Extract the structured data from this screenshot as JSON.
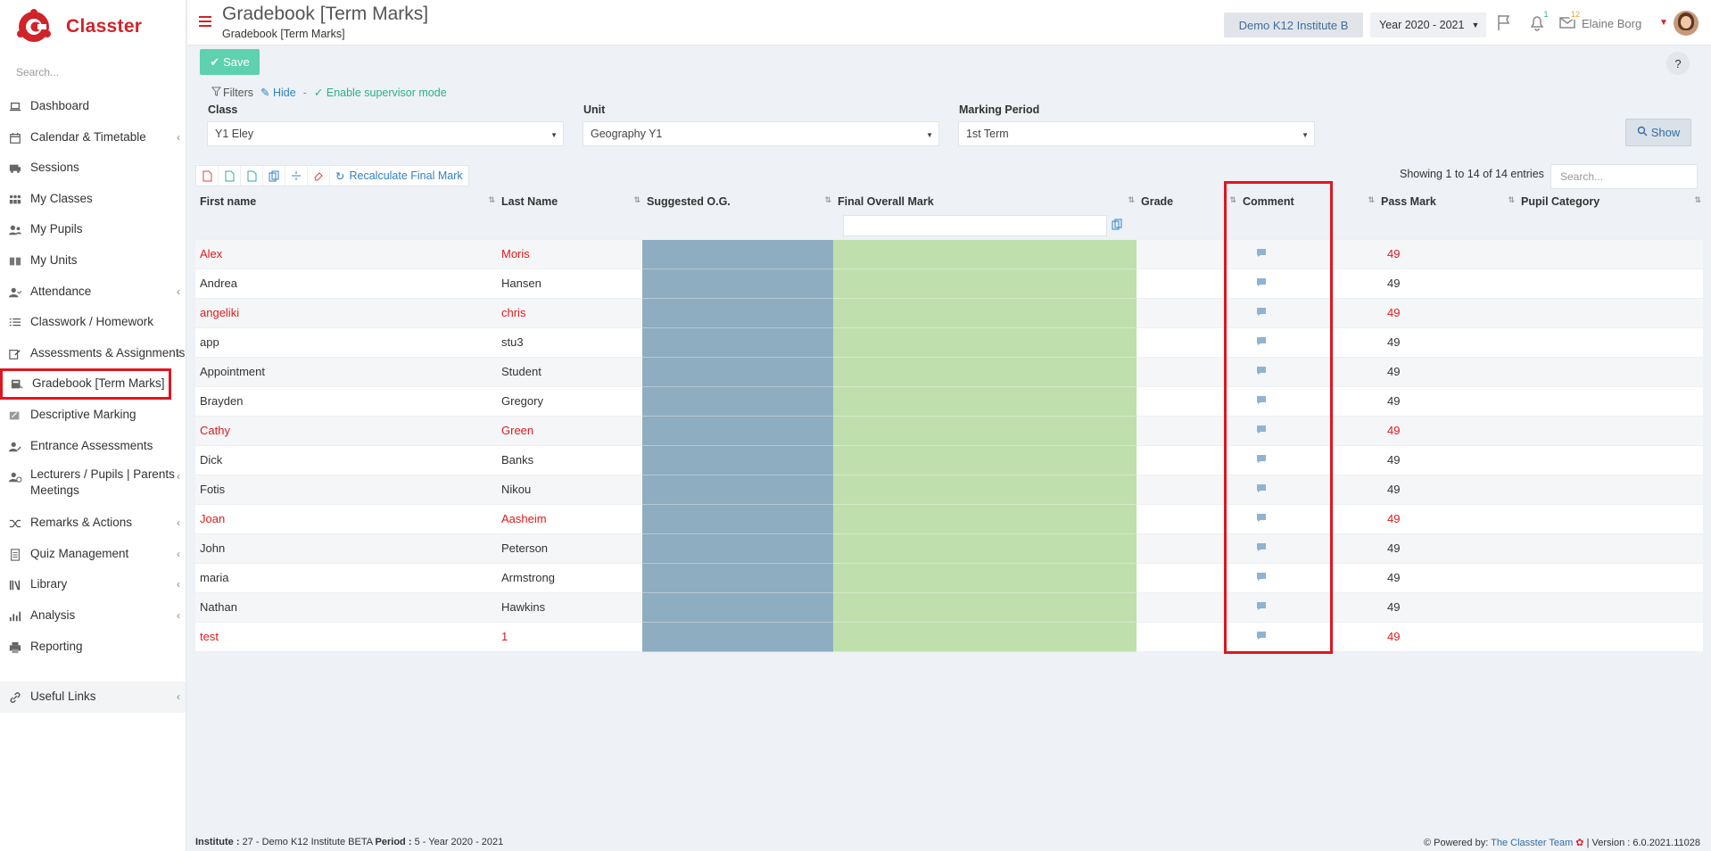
{
  "app": {
    "name": "Classter"
  },
  "sidebar": {
    "search_placeholder": "Search...",
    "items": [
      {
        "label": "Dashboard",
        "icon": "laptop-icon",
        "chevron": false
      },
      {
        "label": "Calendar & Timetable",
        "icon": "calendar-icon",
        "chevron": true
      },
      {
        "label": "Sessions",
        "icon": "bus-icon",
        "chevron": false
      },
      {
        "label": "My Classes",
        "icon": "classes-icon",
        "chevron": false
      },
      {
        "label": "My Pupils",
        "icon": "users-icon",
        "chevron": false
      },
      {
        "label": "My Units",
        "icon": "book-icon",
        "chevron": false
      },
      {
        "label": "Attendance",
        "icon": "user-check-icon",
        "chevron": true
      },
      {
        "label": "Classwork / Homework",
        "icon": "list-icon",
        "chevron": false
      },
      {
        "label": "Assessments & Assignments",
        "icon": "edit-icon",
        "chevron": true
      },
      {
        "label": "Gradebook [Term Marks]",
        "icon": "gradebook-icon",
        "chevron": false,
        "active": true
      },
      {
        "label": "Descriptive Marking",
        "icon": "marking-icon",
        "chevron": false
      },
      {
        "label": "Entrance Assessments",
        "icon": "user-edit-icon",
        "chevron": false
      },
      {
        "label": "Lecturers / Pupils | Parents Meetings",
        "icon": "meeting-icon",
        "chevron": true
      },
      {
        "label": "Remarks & Actions",
        "icon": "shuffle-icon",
        "chevron": true
      },
      {
        "label": "Quiz Management",
        "icon": "quiz-icon",
        "chevron": true
      },
      {
        "label": "Library",
        "icon": "library-icon",
        "chevron": true
      },
      {
        "label": "Analysis",
        "icon": "bar-chart-icon",
        "chevron": true
      },
      {
        "label": "Reporting",
        "icon": "printer-icon",
        "chevron": false
      }
    ],
    "useful_links": "Useful Links"
  },
  "header": {
    "title": "Gradebook [Term Marks]",
    "subtitle": "Gradebook [Term Marks]",
    "institute": "Demo K12 Institute B",
    "year": "Year 2020 - 2021",
    "notifications_count": "1",
    "messages_count": "12",
    "user_name": "Elaine Borg"
  },
  "actions": {
    "save": "Save",
    "help": "?"
  },
  "filters": {
    "label": "Filters",
    "hide": "Hide",
    "separator": "-",
    "supervisor": "Enable supervisor mode",
    "class_label": "Class",
    "class_value": "Y1 Eley",
    "unit_label": "Unit",
    "unit_value": "Geography Y1",
    "period_label": "Marking Period",
    "period_value": "1st Term",
    "show": "Show"
  },
  "toolbar": {
    "recalc": "Recalculate Final Mark"
  },
  "table": {
    "entries_info": "Showing 1 to 14 of 14 entries",
    "search_placeholder": "Search...",
    "columns": [
      "First name",
      "Last Name",
      "Suggested O.G.",
      "Final Overall Mark",
      "Grade",
      "Comment",
      "Pass Mark",
      "Pupil Category"
    ],
    "rows": [
      {
        "first": "Alex",
        "last": "Moris",
        "pass": "49",
        "red": true
      },
      {
        "first": "Andrea",
        "last": "Hansen",
        "pass": "49",
        "red": false
      },
      {
        "first": "angeliki",
        "last": "chris",
        "pass": "49",
        "red": true
      },
      {
        "first": "app",
        "last": "stu3",
        "pass": "49",
        "red": false
      },
      {
        "first": "Appointment",
        "last": "Student",
        "pass": "49",
        "red": false
      },
      {
        "first": "Brayden",
        "last": "Gregory",
        "pass": "49",
        "red": false
      },
      {
        "first": "Cathy",
        "last": "Green",
        "pass": "49",
        "red": true
      },
      {
        "first": "Dick",
        "last": "Banks",
        "pass": "49",
        "red": false
      },
      {
        "first": "Fotis",
        "last": "Nikou",
        "pass": "49",
        "red": false
      },
      {
        "first": "Joan",
        "last": "Aasheim",
        "pass": "49",
        "red": true
      },
      {
        "first": "John",
        "last": "Peterson",
        "pass": "49",
        "red": false
      },
      {
        "first": "maria",
        "last": "Armstrong",
        "pass": "49",
        "red": false
      },
      {
        "first": "Nathan",
        "last": "Hawkins",
        "pass": "49",
        "red": false
      },
      {
        "first": "test",
        "last": "1",
        "pass": "49",
        "red": true
      }
    ]
  },
  "footer": {
    "institute_label": "Institute :",
    "institute_value": "27 - Demo K12 Institute BETA",
    "period_label": "Period :",
    "period_value": "5 - Year 2020 - 2021",
    "powered": "Powered by:",
    "team": "The Classter Team",
    "version": "| Version : 6.0.2021.11028"
  },
  "colors": {
    "brand_red": "#d0232a",
    "save_green": "#5ed1ae",
    "og_blue": "#8fadc0",
    "final_green": "#bfe0ad",
    "link_blue": "#2f82c4",
    "warning_red": "#e01b1b"
  }
}
